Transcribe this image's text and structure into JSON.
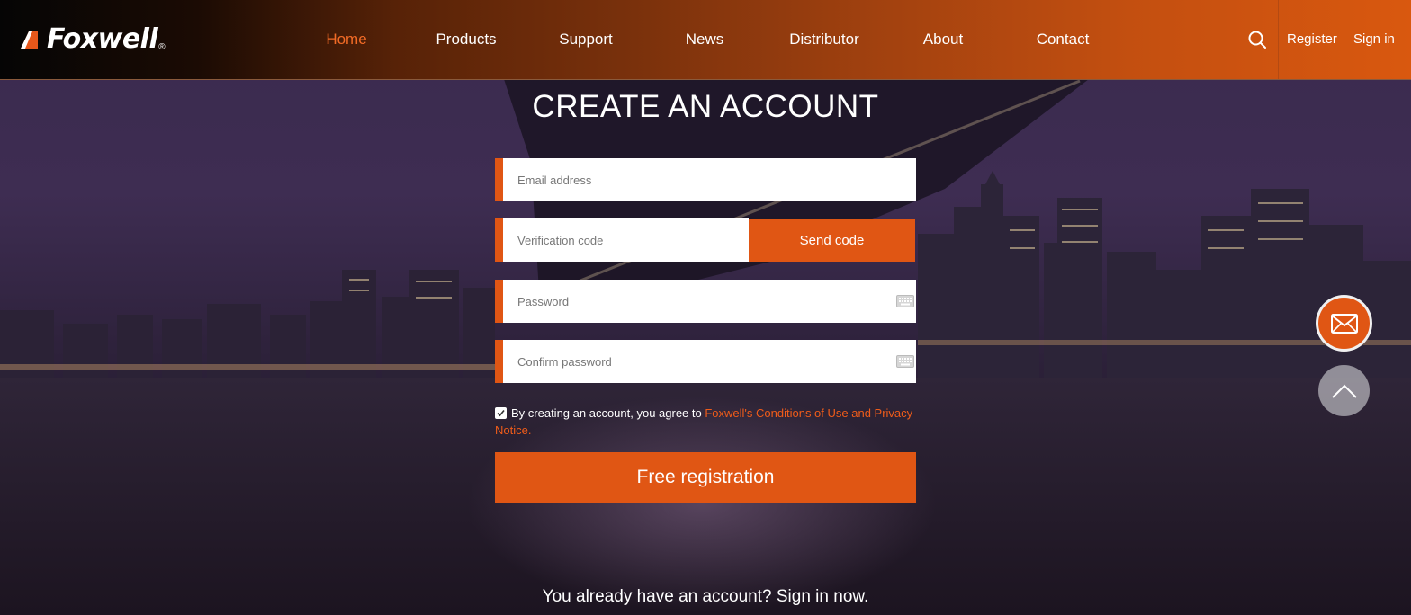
{
  "brand": {
    "name": "Foxwell",
    "registered_mark": "®",
    "accent": "#e05614"
  },
  "nav": {
    "items": [
      {
        "label": "Home",
        "active": true
      },
      {
        "label": "Products"
      },
      {
        "label": "Support"
      },
      {
        "label": "News"
      },
      {
        "label": "Distributor"
      },
      {
        "label": "About"
      },
      {
        "label": "Contact"
      }
    ],
    "search_icon": "search-icon",
    "register_label": "Register",
    "signin_label": "Sign in"
  },
  "form": {
    "title": "CREATE AN ACCOUNT",
    "email_placeholder": "Email address",
    "code_placeholder": "Verification code",
    "send_code_label": "Send code",
    "password_placeholder": "Password",
    "confirm_placeholder": "Confirm password",
    "agree_checked": true,
    "agree_text": "By creating an account, you agree to ",
    "agree_link": "Foxwell's Conditions of Use and Privacy Notice.",
    "submit_label": "Free registration",
    "signin_prompt": "You already have an account? Sign in now."
  },
  "floating": {
    "mail_icon": "mail-icon",
    "top_icon": "chevron-up-icon"
  }
}
